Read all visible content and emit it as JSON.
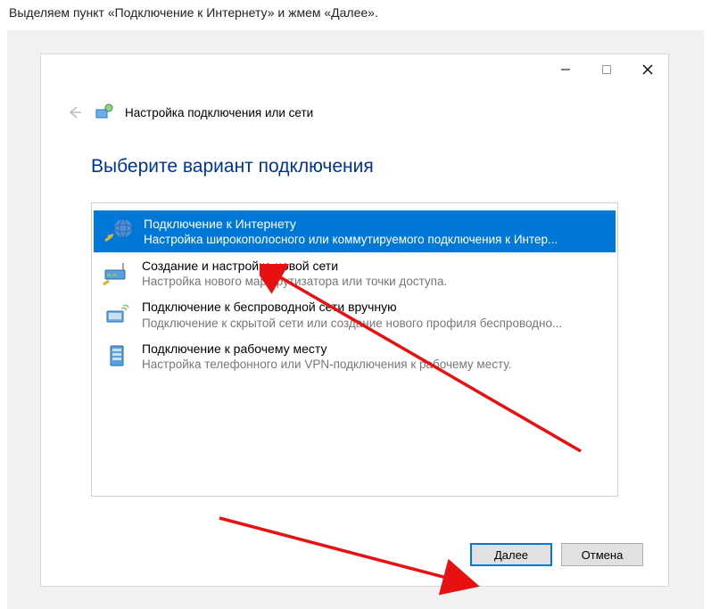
{
  "instruction": "Выделяем пункт «Подключение к Интернету» и жмем «Далее».",
  "window": {
    "header_title": "Настройка подключения или сети"
  },
  "page": {
    "heading": "Выберите вариант подключения"
  },
  "options": [
    {
      "title": "Подключение к Интернету",
      "desc": "Настройка широкополосного или коммутируемого подключения к Интер...",
      "selected": true,
      "icon": "globe-icon"
    },
    {
      "title": "Создание и настройка новой сети",
      "desc": "Настройка нового маршрутизатора или точки доступа.",
      "selected": false,
      "icon": "router-icon"
    },
    {
      "title": "Подключение к беспроводной сети вручную",
      "desc": "Подключение к скрытой сети или создание нового профиля беспроводно...",
      "selected": false,
      "icon": "wireless-icon"
    },
    {
      "title": "Подключение к рабочему месту",
      "desc": "Настройка телефонного или VPN-подключения к рабочему месту.",
      "selected": false,
      "icon": "server-icon"
    }
  ],
  "buttons": {
    "next": "Далее",
    "cancel": "Отмена"
  }
}
